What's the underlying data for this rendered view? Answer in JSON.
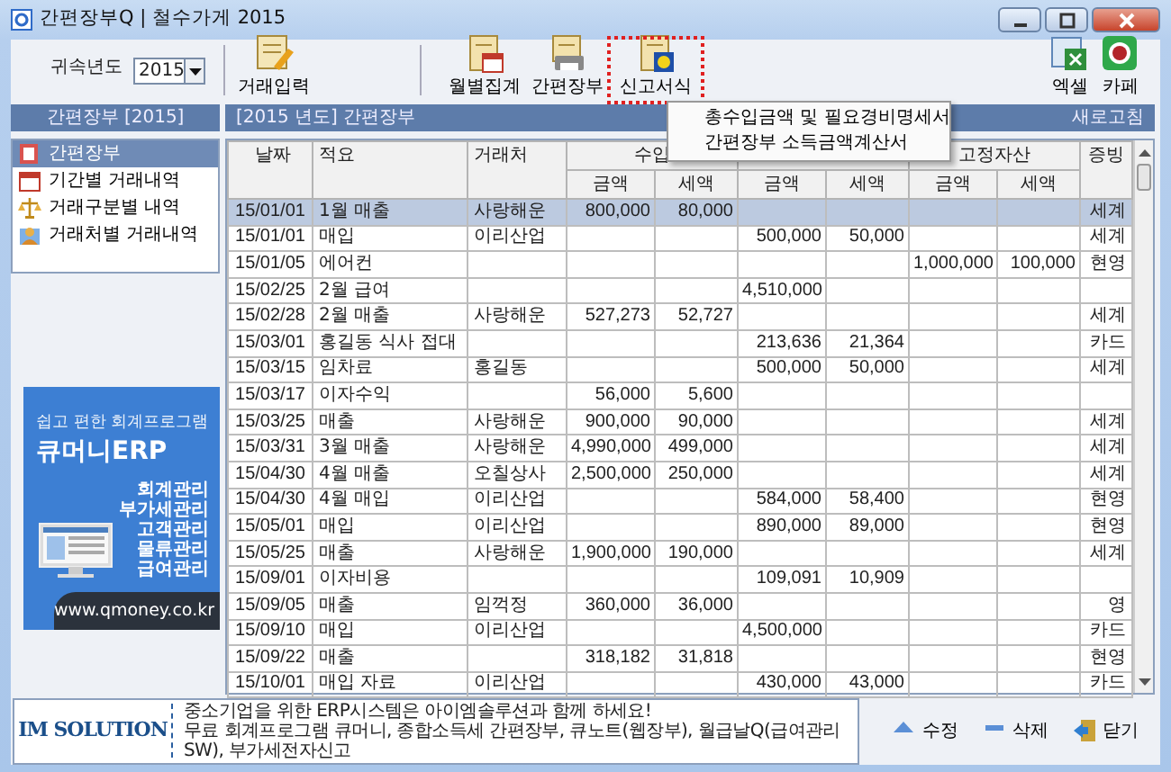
{
  "window": {
    "title": "간편장부Q | 철수가게 2015"
  },
  "toolbar": {
    "year_label": "귀속년도",
    "year": "2015",
    "entry_buttons": [
      {
        "label": "거래입력",
        "kind": "entry",
        "highlighted": false
      }
    ],
    "report_buttons": [
      {
        "label": "월별집계",
        "kind": "monthly",
        "highlighted": false
      },
      {
        "label": "간편장부",
        "kind": "ledger",
        "highlighted": false
      },
      {
        "label": "신고서식",
        "kind": "report",
        "highlighted": true
      }
    ],
    "export_buttons": [
      {
        "label": "엑셀",
        "kind": "excel",
        "highlighted": false
      },
      {
        "label": "카페",
        "kind": "cafe",
        "highlighted": false
      }
    ]
  },
  "dropdown_menu": {
    "items": [
      "총수입금액 및 필요경비명세서",
      "간편장부 소득금액계산서"
    ]
  },
  "sidebar": {
    "title": "간편장부 [2015]",
    "items": [
      {
        "label": "간편장부",
        "kind": "ledger",
        "selected": true
      },
      {
        "label": "기간별 거래내역",
        "kind": "calendar",
        "selected": false
      },
      {
        "label": "거래구분별 내역",
        "kind": "scale",
        "selected": false
      },
      {
        "label": "거래처별 거래내역",
        "kind": "contact",
        "selected": false
      }
    ],
    "ad": {
      "tagline": "쉽고 편한 회계프로그램",
      "product": "큐머니ERP",
      "features": [
        "회계관리",
        "부가세관리",
        "고객관리",
        "물류관리",
        "급여관리"
      ],
      "url": "www.qmoney.co.kr"
    }
  },
  "main": {
    "title": "[2015 년도] 간편장부",
    "refresh": "새로고침",
    "table": {
      "columns": {
        "date": "날짜",
        "memo": "적요",
        "partner": "거래처",
        "proof": "증빙"
      },
      "column_groups": [
        {
          "label": "수입",
          "sub": [
            "금액",
            "세액"
          ]
        },
        {
          "sub": [
            "금액",
            "세액"
          ]
        },
        {
          "label": "고정자산",
          "sub": [
            "금액",
            "세액"
          ]
        }
      ],
      "rows": [
        {
          "selected": true,
          "date": "15/01/01",
          "memo": "1월 매출",
          "partner": "사랑해운",
          "income_amount": "800,000",
          "income_tax": "80,000",
          "proof": "세계"
        },
        {
          "selected": false,
          "date": "15/01/01",
          "memo": "매입",
          "partner": "이리산업",
          "group_2_amount": "500,000",
          "group_2_tax": "50,000",
          "proof": "세계"
        },
        {
          "selected": false,
          "date": "15/01/05",
          "memo": "에어컨",
          "asset_amount": "1,000,000",
          "asset_tax": "100,000",
          "proof": "현영"
        },
        {
          "selected": false,
          "date": "15/02/25",
          "memo": "2월 급여",
          "group_2_amount": "4,510,000"
        },
        {
          "selected": false,
          "date": "15/02/28",
          "memo": "2월 매출",
          "partner": "사랑해운",
          "income_amount": "527,273",
          "income_tax": "52,727",
          "proof": "세계"
        },
        {
          "selected": false,
          "date": "15/03/01",
          "memo": "홍길동 식사 접대",
          "group_2_amount": "213,636",
          "group_2_tax": "21,364",
          "proof": "카드"
        },
        {
          "selected": false,
          "date": "15/03/15",
          "memo": "임차료",
          "partner": "홍길동",
          "group_2_amount": "500,000",
          "group_2_tax": "50,000",
          "proof": "세계"
        },
        {
          "selected": false,
          "date": "15/03/17",
          "memo": "이자수익",
          "income_amount": "56,000",
          "income_tax": "5,600"
        },
        {
          "selected": false,
          "date": "15/03/25",
          "memo": "매출",
          "partner": "사랑해운",
          "income_amount": "900,000",
          "income_tax": "90,000",
          "proof": "세계"
        },
        {
          "selected": false,
          "date": "15/03/31",
          "memo": "3월 매출",
          "partner": "사랑해운",
          "income_amount": "4,990,000",
          "income_tax": "499,000",
          "proof": "세계"
        },
        {
          "selected": false,
          "date": "15/04/30",
          "memo": "4월 매출",
          "partner": "오칠상사",
          "income_amount": "2,500,000",
          "income_tax": "250,000",
          "proof": "세계"
        },
        {
          "selected": false,
          "date": "15/04/30",
          "memo": "4월 매입",
          "partner": "이리산업",
          "group_2_amount": "584,000",
          "group_2_tax": "58,400",
          "proof": "현영"
        },
        {
          "selected": false,
          "date": "15/05/01",
          "memo": "매입",
          "partner": "이리산업",
          "group_2_amount": "890,000",
          "group_2_tax": "89,000",
          "proof": "현영"
        },
        {
          "selected": false,
          "date": "15/05/25",
          "memo": "매출",
          "partner": "사랑해운",
          "income_amount": "1,900,000",
          "income_tax": "190,000",
          "proof": "세계"
        },
        {
          "selected": false,
          "date": "15/09/01",
          "memo": "이자비용",
          "group_2_amount": "109,091",
          "group_2_tax": "10,909"
        },
        {
          "selected": false,
          "date": "15/09/05",
          "memo": "매출",
          "partner": "임꺽정",
          "income_amount": "360,000",
          "income_tax": "36,000",
          "proof": "영"
        },
        {
          "selected": false,
          "date": "15/09/10",
          "memo": "매입",
          "partner": "이리산업",
          "group_2_amount": "4,500,000",
          "proof": "카드"
        },
        {
          "selected": false,
          "date": "15/09/22",
          "memo": "매출",
          "income_amount": "318,182",
          "income_tax": "31,818",
          "proof": "현영"
        },
        {
          "selected": false,
          "date": "15/10/01",
          "memo": "매입 자료",
          "partner": "이리산업",
          "group_2_amount": "430,000",
          "group_2_tax": "43,000",
          "proof": "카드"
        }
      ]
    }
  },
  "footer": {
    "logo": "IM SOLUTION",
    "notice": [
      "중소기업을 위한 ERP시스템은 아이엠솔루션과 함께 하세요!",
      "무료 회계프로그램 큐머니, 종합소득세 간편장부, 큐노트(웹장부), 월급날Q(급여관리SW), 부가세전자신고"
    ],
    "buttons": [
      {
        "label": "수정",
        "kind": "edit"
      },
      {
        "label": "삭제",
        "kind": "delete"
      },
      {
        "label": "닫기",
        "kind": "close"
      }
    ]
  }
}
